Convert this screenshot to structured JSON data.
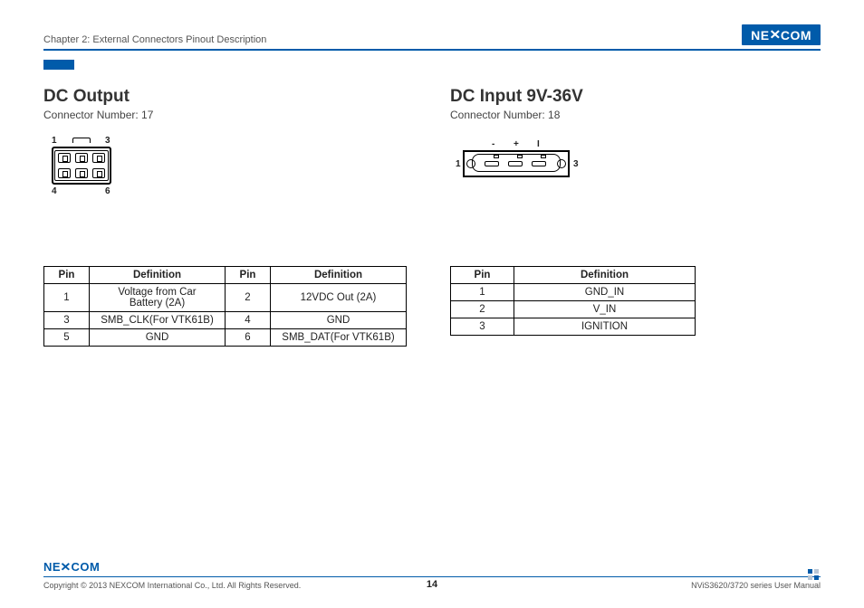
{
  "header": {
    "chapter": "Chapter 2: External Connectors Pinout Description",
    "brand": "NEXCOM"
  },
  "left": {
    "title": "DC Output",
    "connector_label": "Connector Number: 17",
    "diagram_labels": {
      "tl": "1",
      "tr": "3",
      "bl": "4",
      "br": "6"
    },
    "table": {
      "headers": [
        "Pin",
        "Definition",
        "Pin",
        "Definition"
      ],
      "rows": [
        [
          "1",
          "Voltage from Car Battery (2A)",
          "2",
          "12VDC Out (2A)"
        ],
        [
          "3",
          "SMB_CLK(For VTK61B)",
          "4",
          "GND"
        ],
        [
          "5",
          "GND",
          "6",
          "SMB_DAT(For VTK61B)"
        ]
      ]
    }
  },
  "right": {
    "title": "DC Input 9V-36V",
    "connector_label": "Connector Number: 18",
    "diagram_labels": {
      "left": "1",
      "right": "3",
      "minus": "-",
      "plus": "+",
      "ign": "I"
    },
    "table": {
      "headers": [
        "Pin",
        "Definition"
      ],
      "rows": [
        [
          "1",
          "GND_IN"
        ],
        [
          "2",
          "V_IN"
        ],
        [
          "3",
          "IGNITION"
        ]
      ]
    }
  },
  "footer": {
    "brand": "NEXCOM",
    "copyright": "Copyright © 2013 NEXCOM International Co., Ltd. All Rights Reserved.",
    "page": "14",
    "manual": "NViS3620/3720 series User Manual"
  }
}
